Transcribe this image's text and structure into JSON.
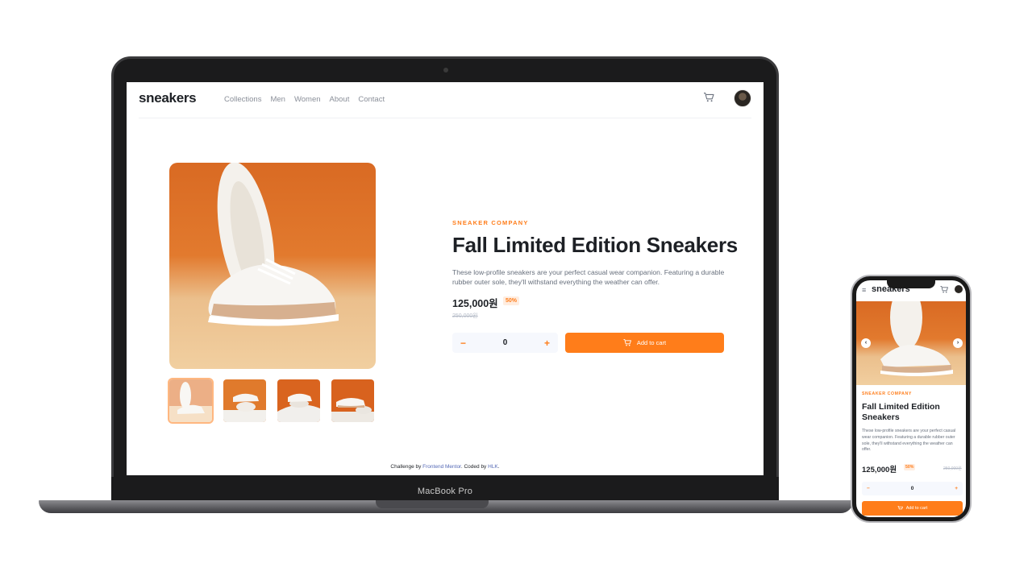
{
  "device_labels": {
    "laptop": "MacBook Pro"
  },
  "brand": {
    "logo": "sneakers",
    "accent_color": "#ff7d1a"
  },
  "nav": {
    "links": [
      "Collections",
      "Men",
      "Women",
      "About",
      "Contact"
    ],
    "cart_icon": "cart-icon",
    "avatar_icon": "avatar"
  },
  "product": {
    "company": "SNEAKER COMPANY",
    "title": "Fall Limited Edition Sneakers",
    "description": "These low-profile sneakers are your perfect casual wear companion. Featuring a durable rubber outer sole, they'll withstand everything the weather can offer.",
    "price": "125,000원",
    "discount": "50%",
    "old_price": "250,000원",
    "quantity": "0",
    "minus_symbol": "−",
    "plus_symbol": "+",
    "add_to_cart": "Add to cart",
    "thumbnail_count": 4,
    "active_thumbnail": 1
  },
  "attribution": {
    "prefix": "Challenge by",
    "frontend_mentor": "Frontend Mentor",
    "middle": ". Coded by",
    "author": "HLK",
    "suffix": "."
  },
  "mobile": {
    "menu_icon": "≡",
    "prev_icon": "‹",
    "next_icon": "›"
  }
}
